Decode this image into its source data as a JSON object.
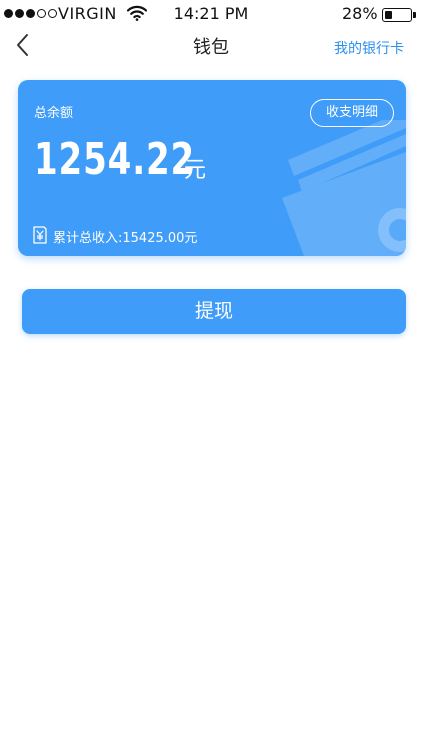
{
  "status_bar": {
    "carrier": "VIRGIN",
    "time": "14:21 PM",
    "battery_percent": "28%",
    "battery_level": 0.28,
    "signal_bars_filled": 3,
    "signal_bars_total": 5
  },
  "nav": {
    "title": "钱包",
    "back_icon": "chevron-left-icon",
    "bank_card_link": "我的银行卡"
  },
  "wallet_card": {
    "total_label": "总余额",
    "detail_button": "收支明细",
    "balance": "1254.22",
    "currency": "元",
    "income_text": "累计总收入:15425.00元",
    "income_icon": "yuan-receipt-icon",
    "background_color": "#3f9cf8"
  },
  "actions": {
    "withdraw_label": "提现"
  },
  "colors": {
    "accent": "#3f9cf8",
    "link": "#2b8ff0"
  }
}
